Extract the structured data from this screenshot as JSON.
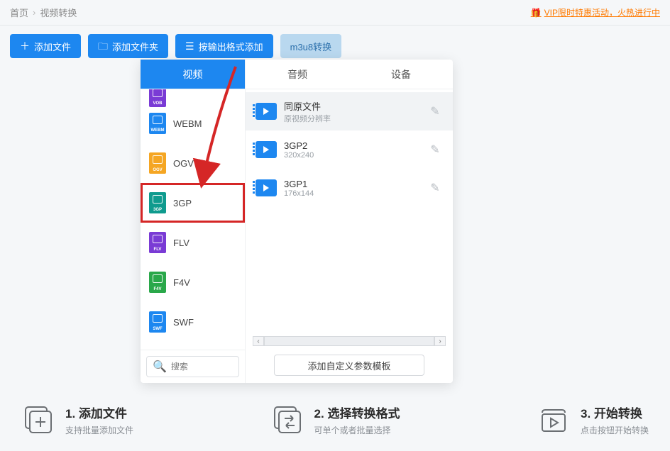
{
  "breadcrumb": {
    "home": "首页",
    "current": "视频转换"
  },
  "vip": {
    "label": "VIP限时特惠活动，火热进行中"
  },
  "toolbar": {
    "add_file": "添加文件",
    "add_folder": "添加文件夹",
    "add_by_format": "按输出格式添加",
    "m3u8": "m3u8转换"
  },
  "popup": {
    "cat_video": "视频",
    "preset_tab_audio": "音频",
    "preset_tab_device": "设备",
    "formats": [
      {
        "ext": "VOB",
        "label": "",
        "color": "#7a3bd5"
      },
      {
        "ext": "WEBM",
        "label": "WEBM",
        "color": "#1d87f0"
      },
      {
        "ext": "OGV",
        "label": "OGV",
        "color": "#f5a623"
      },
      {
        "ext": "3GP",
        "label": "3GP",
        "color": "#0f9b8e",
        "highlight": true
      },
      {
        "ext": "FLV",
        "label": "FLV",
        "color": "#7a3bd5"
      },
      {
        "ext": "F4V",
        "label": "F4V",
        "color": "#2aa84a"
      },
      {
        "ext": "SWF",
        "label": "SWF",
        "color": "#1d87f0"
      }
    ],
    "search_placeholder": "搜索",
    "presets": [
      {
        "title": "同原文件",
        "sub": "原视频分辨率",
        "selected": true
      },
      {
        "title": "3GP2",
        "sub": "320x240"
      },
      {
        "title": "3GP1",
        "sub": "176x144"
      }
    ],
    "add_custom": "添加自定义参数模板"
  },
  "steps": {
    "s1": {
      "title": "1. 添加文件",
      "sub": "支持批量添加文件"
    },
    "s2": {
      "title": "2. 选择转换格式",
      "sub": "可单个或者批量选择"
    },
    "s3": {
      "title": "3. 开始转换",
      "sub": "点击按钮开始转换"
    }
  }
}
